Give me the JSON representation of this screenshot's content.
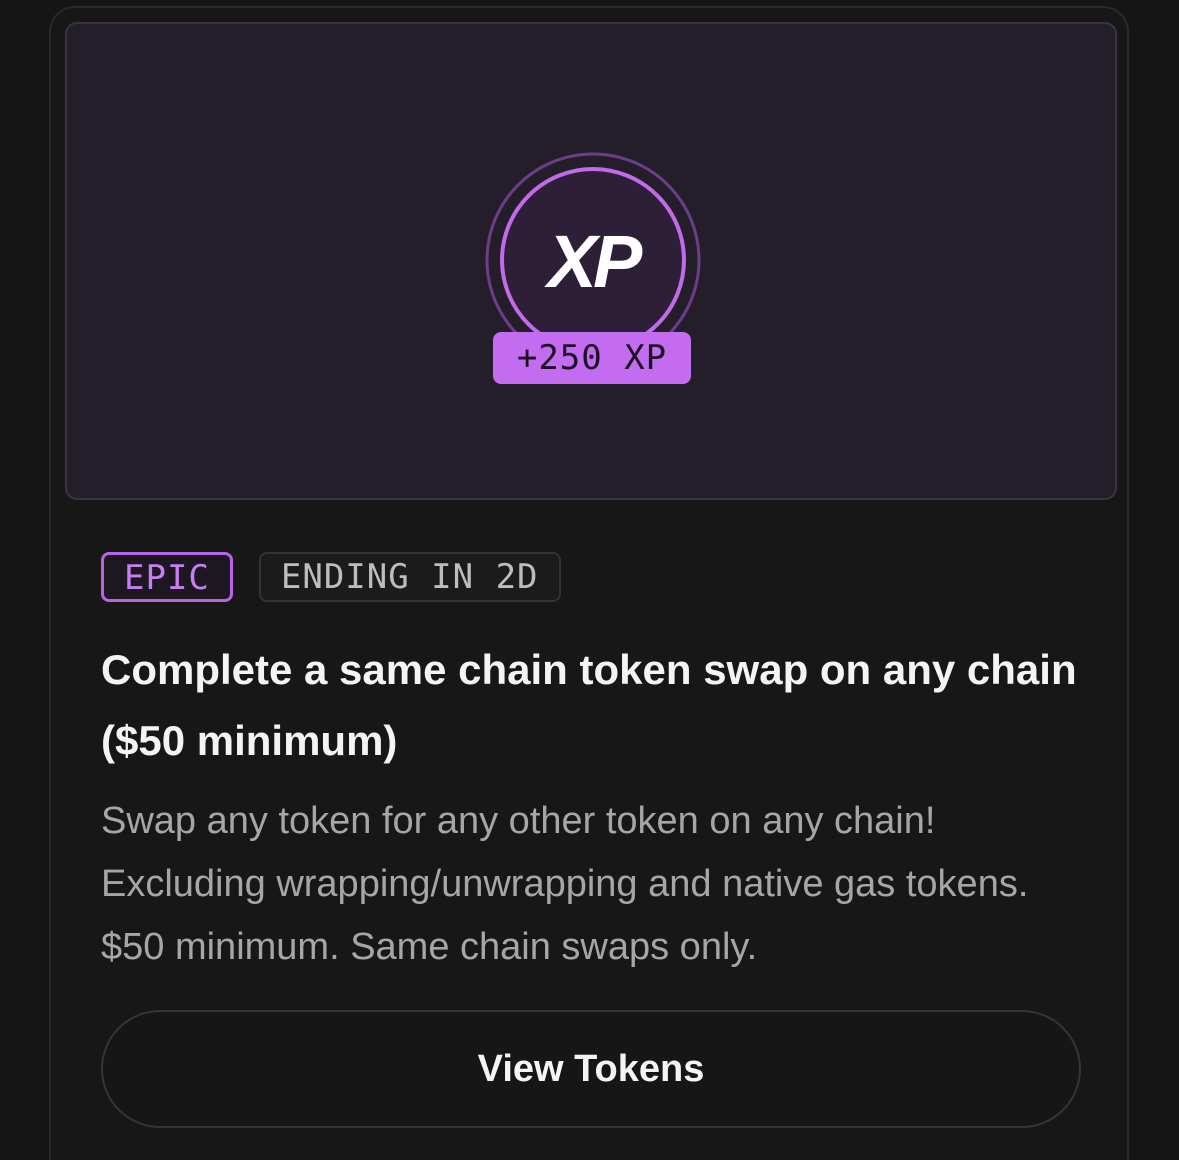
{
  "quest": {
    "reward_label": "+250 XP",
    "badge_icon": "xp-badge-icon",
    "badge_text": "XP",
    "tags": {
      "rarity": "EPIC",
      "ending": "ENDING IN 2D"
    },
    "title": "Complete a same chain token swap on any chain ($50 minimum)",
    "description": "Swap any token for any other token on any chain! Excluding wrapping/unwrapping and native gas tokens. $50 minimum. Same chain swaps only.",
    "action_label": "View Tokens"
  },
  "colors": {
    "accent": "#c46cf0",
    "hero_bg": "#241e2b",
    "page_bg": "#151515"
  }
}
